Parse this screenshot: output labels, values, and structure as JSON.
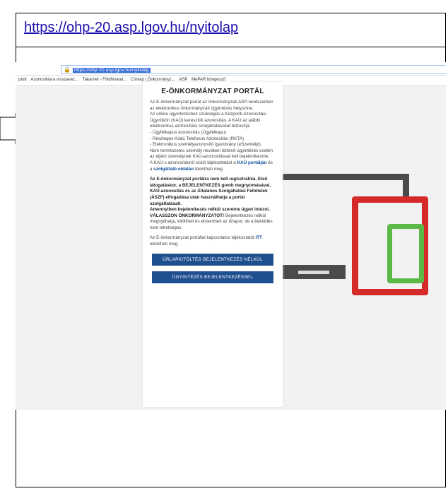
{
  "caption": {
    "url": "https://ohp-20.asp.lgov.hu/nyitolap"
  },
  "browser": {
    "address_url": "https://ohp-20.asp.lgov.hu/nyitolap",
    "bookmarks": [
      "ptott",
      "Azonosításra visszavez...",
      "Takarnet - Földhivatal...",
      "Címlap | Önkormányz...",
      "ASP",
      "MePAR böngésző"
    ]
  },
  "portal": {
    "title": "E-ÖNKORMÁNYZAT PORTÁL",
    "intro": "Az E-önkormányzat portál az önkormányzati ASP-rendszerben az elektronikus önkormányzati ügyintézés helyszíne.",
    "kau_intro": "Az online ügyintézéshez szükséges a Központi Azonosítási Ügynökön (KAÜ) keresztüli azonosítás. A KAÜ az alábbi elektronikus azonosítási szolgáltatásokat biztosítja:",
    "kau_items": [
      "- Ügyfélkapus azonosítás (Ügyfélkapu)",
      "- Részleges Kódú Telefonos Azonosítás (RKTA)",
      "- Elektronikus személyazonosító igazolvány (eSzemélyi)."
    ],
    "non_natural": "Nem természetes személy nevében történő ügyintézés esetén az eljáró személynek KAÜ-azonosítással kell bejelentkeznie.",
    "kau_info_pre": "A KAÜ-s azonosításról szóló tájékoztatást a",
    "kau_link1": "KAÜ portálján",
    "kau_info_mid": "és a",
    "kau_link2": "szolgáltató oldalán",
    "kau_info_post": "tekintheti meg.",
    "bold_block": "Az E-önkormányzat portálra nem kell regisztrálnia. Első látogatáskor, a BEJELENTKEZÉS gomb megnyomásával, KAÜ-azonosítás és az Általános Szolgáltatási Feltételek (ÁSZF) elfogadása után használhatja a portál szolgáltatásait.",
    "choose_bold": "Amennyiben bejelentkezés nélkül szeretne ügyet intézni, VÁLASSZON ÖNKORMÁNYZATOT!",
    "choose_rest": "Bejelentkezés nélkül megnyithatja, kitöltheti és elmentheti az űrlapot, de a beküldés nem lehetséges.",
    "contact_pre": "Az E-önkormányzat portállal kapcsolatos tájékoztatót",
    "contact_link": "ITT",
    "contact_post": "tekintheti meg.",
    "btn_form": "ŰRLAPKITÖLTÉS BEJELENTKEZÉS NÉLKÜL",
    "btn_login": "ÜGYINTÉZÉS BEJELENTKEZÉSSEL"
  },
  "colors": {
    "link": "#1a0dab",
    "button": "#1e4f8f",
    "tablet": "#d62a2a",
    "phone": "#5cb947",
    "laptop": "#4b4b4b"
  }
}
